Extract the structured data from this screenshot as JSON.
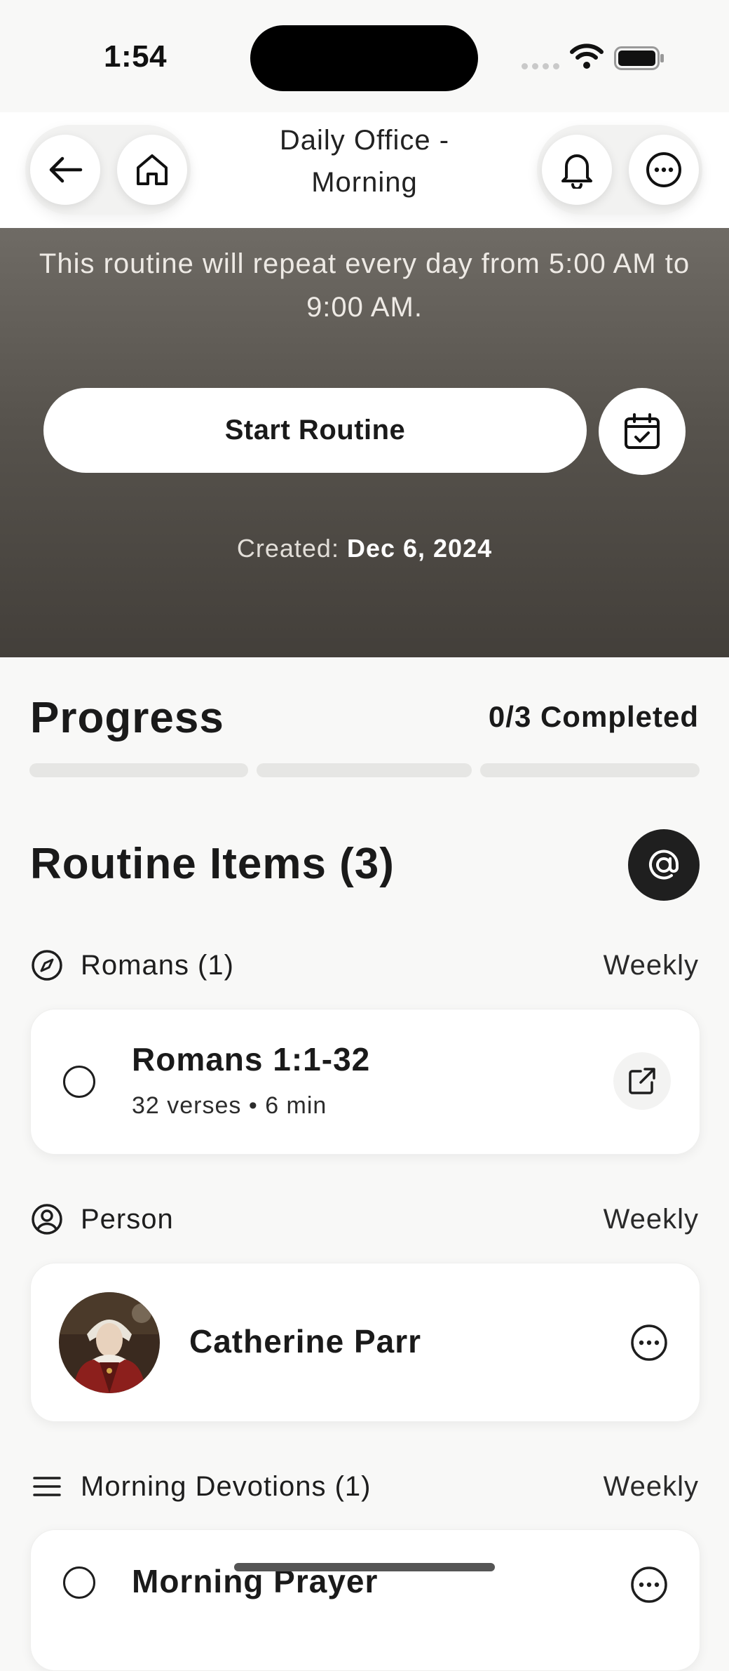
{
  "status_bar": {
    "time": "1:54"
  },
  "header": {
    "title": "Daily Office - Morning"
  },
  "hero": {
    "description": "This routine will repeat every day from 5:00 AM to 9:00 AM.",
    "start_label": "Start Routine",
    "created_label": "Created:",
    "created_date": "Dec 6, 2024"
  },
  "progress": {
    "title": "Progress",
    "completed_text": "0/3 Completed",
    "completed": 0,
    "total": 3
  },
  "routine_items": {
    "title": "Routine Items (3)",
    "groups": [
      {
        "name": "Romans (1)",
        "frequency": "Weekly",
        "icon": "compass-icon",
        "item": {
          "title": "Romans 1:1-32",
          "subtitle": "32 verses • 6 min",
          "action_icon": "external-link-icon"
        }
      },
      {
        "name": "Person",
        "frequency": "Weekly",
        "icon": "user-circle-icon",
        "item": {
          "title": "Catherine Parr",
          "action_icon": "more-icon"
        }
      },
      {
        "name": "Morning Devotions (1)",
        "frequency": "Weekly",
        "icon": "list-icon",
        "item": {
          "title": "Morning Prayer",
          "action_icon": "more-icon"
        }
      }
    ]
  }
}
